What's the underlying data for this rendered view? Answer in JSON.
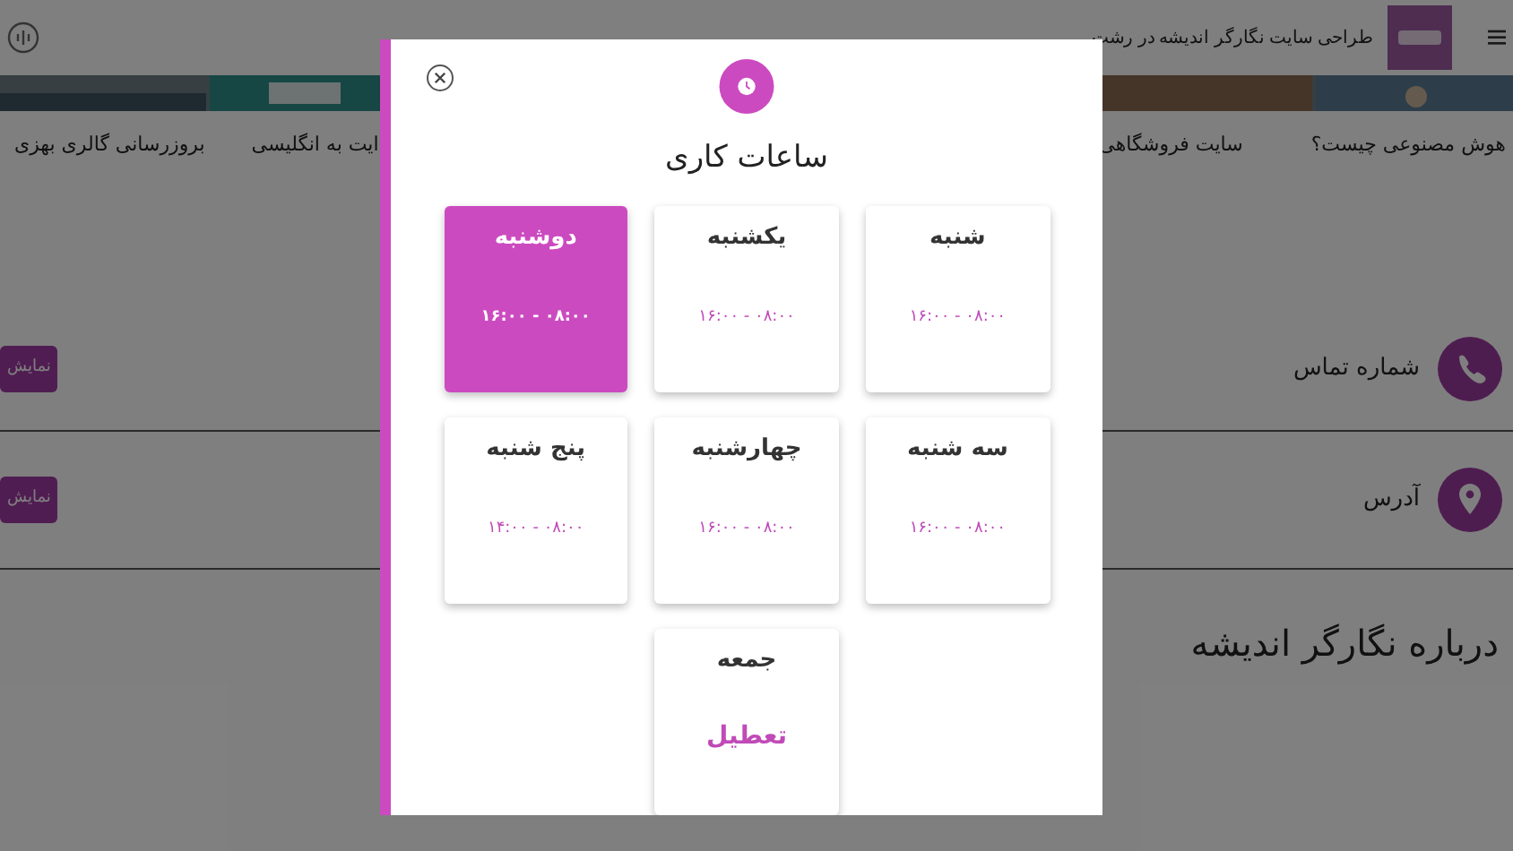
{
  "header": {
    "title": "طراحی سایت نگارگر اندیشه در رشت"
  },
  "articles": [
    {
      "title": "هوش مصنوعی چیست؟"
    },
    {
      "title": "سایت فروشگاهی"
    },
    {
      "title": "ایت به انگلیسی"
    },
    {
      "title": "بروزرسانی گالری بهزی"
    }
  ],
  "contacts": [
    {
      "kind": "phone",
      "label": "شماره تماس",
      "button": "نمایش"
    },
    {
      "kind": "address",
      "label": "آدرس",
      "button": "نمایش"
    }
  ],
  "about": {
    "heading": "درباره نگارگر اندیشه"
  },
  "modal": {
    "title": "ساعات کاری",
    "days": [
      {
        "name": "شنبه",
        "kind": "open",
        "hours": "۱۶:۰۰ - ۰۸:۰۰",
        "selected": false
      },
      {
        "name": "یکشنبه",
        "kind": "open",
        "hours": "۱۶:۰۰ - ۰۸:۰۰",
        "selected": false
      },
      {
        "name": "دوشنبه",
        "kind": "open",
        "hours": "۱۶:۰۰ - ۰۸:۰۰",
        "selected": true
      },
      {
        "name": "سه شنبه",
        "kind": "open",
        "hours": "۱۶:۰۰ - ۰۸:۰۰",
        "selected": false
      },
      {
        "name": "چهارشنبه",
        "kind": "open",
        "hours": "۱۶:۰۰ - ۰۸:۰۰",
        "selected": false
      },
      {
        "name": "پنج شنبه",
        "kind": "open",
        "hours": "۱۴:۰۰ - ۰۸:۰۰",
        "selected": false
      },
      {
        "name": "جمعه",
        "kind": "closed",
        "hours": "تعطیل",
        "selected": false
      }
    ]
  }
}
